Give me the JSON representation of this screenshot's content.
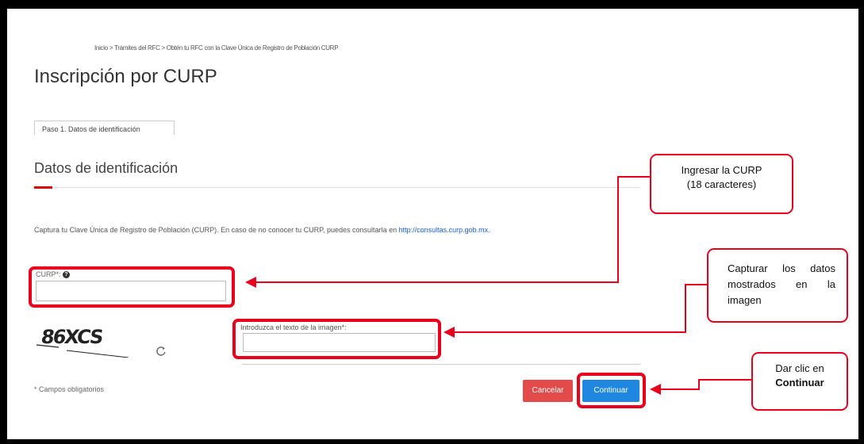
{
  "breadcrumb": {
    "home": "Inicio",
    "sep1": " > ",
    "tramites": "Trámites del RFC",
    "sep2": " > ",
    "current": "Obtén tu RFC con la Clave Única de Registro de Población CURP"
  },
  "page_title": "Inscripción por CURP",
  "step_tab": "Paso 1. Datos de identificación",
  "section_title": "Datos de identificación",
  "description": {
    "text": "Captura tu Clave Única de Registro de Población (CURP). En caso de no conocer tu CURP, puedes consultarla en ",
    "link": "http://consultas.curp.gob.mx."
  },
  "form": {
    "curp_label": "CURP*:",
    "curp_help_icon": "question-circle-icon",
    "curp_value": "",
    "captcha_text": "86XCS",
    "refresh_icon": "refresh-icon",
    "image_text_label": "Introduzca el texto de la imagen*:",
    "image_text_value": "",
    "required_note": "* Campos obligatorios",
    "cancel_label": "Cancelar",
    "continue_label": "Continuar"
  },
  "callouts": {
    "curp": [
      "Ingresar la CURP",
      "(18 caracteres)"
    ],
    "captcha": "Capturar los datos mostrados en la imagen",
    "continue_prefix": "Dar clic en",
    "continue_bold": "Continuar"
  },
  "colors": {
    "highlight": "#e8001c",
    "cancel_button": "#e34b4b",
    "continue_button": "#1f87e0",
    "link": "#1a5fd6",
    "section_accent": "#dd0000"
  }
}
